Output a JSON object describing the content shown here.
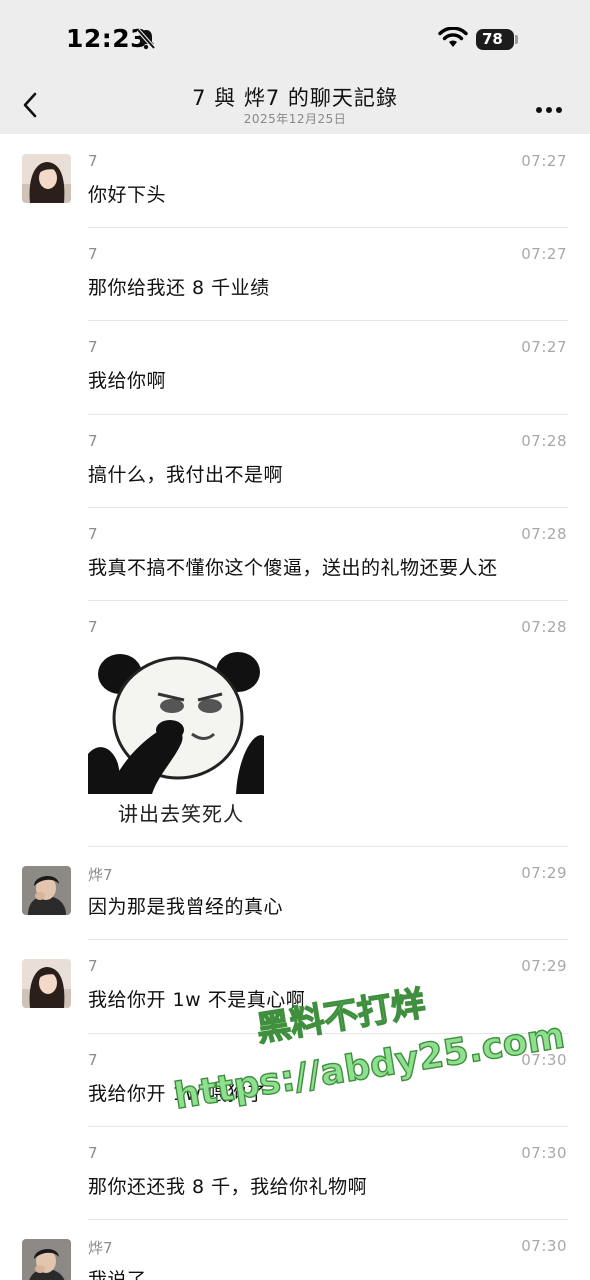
{
  "status": {
    "time": "12:23",
    "battery": "78"
  },
  "header": {
    "title": "7 與 烨7 的聊天記錄",
    "date": "2025年12月25日"
  },
  "messages": [
    {
      "sender": "7",
      "time": "07:27",
      "text": "你好下头",
      "avatar": "female"
    },
    {
      "sender": "7",
      "time": "07:27",
      "text": "那你给我还 8 千业绩"
    },
    {
      "sender": "7",
      "time": "07:27",
      "text": "我给你啊"
    },
    {
      "sender": "7",
      "time": "07:28",
      "text": "搞什么，我付出不是啊"
    },
    {
      "sender": "7",
      "time": "07:28",
      "text": "我真不搞不懂你这个傻逼，送出的礼物还要人还"
    },
    {
      "sender": "7",
      "time": "07:28",
      "sticker_caption": "讲出去笑死人"
    },
    {
      "sender": "烨7",
      "time": "07:29",
      "text": "因为那是我曾经的真心",
      "avatar": "male"
    },
    {
      "sender": "7",
      "time": "07:29",
      "text": "我给你开 1w 不是真心啊",
      "avatar": "female"
    },
    {
      "sender": "7",
      "time": "07:30",
      "text": "我给你开 1w 喂狗了"
    },
    {
      "sender": "7",
      "time": "07:30",
      "text": "那你还还我 8 千，我给你礼物啊"
    },
    {
      "sender": "烨7",
      "time": "07:30",
      "text": "我说了",
      "avatar": "male"
    }
  ],
  "watermark": {
    "line1": "黑料不打烊",
    "line2": "https://abdy25.com"
  },
  "icons": [
    "bell-slash-icon",
    "wifi-icon",
    "battery-icon",
    "back-icon",
    "more-icon",
    "panda-sticker"
  ]
}
